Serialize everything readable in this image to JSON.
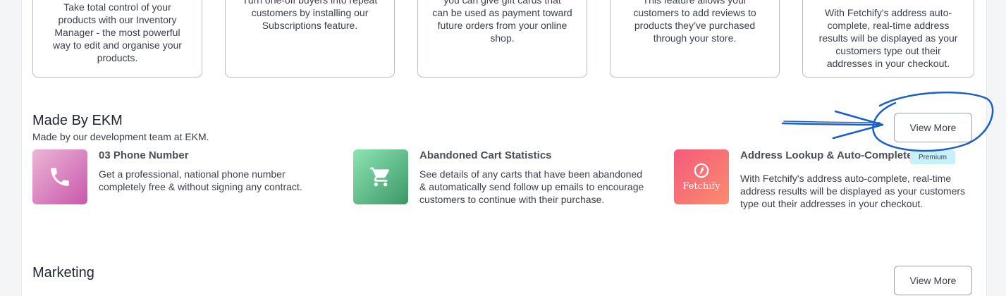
{
  "top_cards": [
    {
      "desc": "Take total control of your\nproducts with our Inventory\nManager - the most powerful\nway to edit and organise your\nproducts."
    },
    {
      "desc": "Turn one-off buyers into repeat\ncustomers by installing our\nSubscriptions feature."
    },
    {
      "desc": "you can give gift cards that\ncan be used as payment toward\nfuture orders from your online\nshop."
    },
    {
      "desc": "This feature allows your\ncustomers to add reviews to\nproducts they’ve purchased\nthrough your store."
    },
    {
      "desc": "With Fetchify's address auto-\ncomplete, real-time address\nresults will be displayed as your\ncustomers type out their\naddresses in your checkout."
    }
  ],
  "made_by_ekm": {
    "title": "Made By EKM",
    "subtitle": "Made by our development team at EKM.",
    "view_more": "View More",
    "apps": [
      {
        "name": "03 Phone Number",
        "text": "Get a professional, national phone number\ncompletely free & without signing any contract.",
        "icon": "phone-icon"
      },
      {
        "name": "Abandoned Cart Statistics",
        "text": "See details of any carts that have been abandoned\n& automatically send follow up emails to encourage\ncustomers to continue with their purchase.",
        "icon": "cart-icon"
      },
      {
        "name": "Address Lookup & Auto-Complete",
        "text": "With Fetchify's address auto-complete, real-time\naddress results will be displayed as your customers\ntype out their addresses in your checkout.",
        "icon": "fetchify-logo",
        "logo_text": "Fetchify",
        "badge": "Premium"
      }
    ]
  },
  "marketing": {
    "title": "Marketing",
    "view_more": "View More"
  },
  "colors": {
    "phone_tile": "#d470b5",
    "cart_tile": "#4fb980",
    "fetchify_tile": "#f56f78",
    "badge_bg": "#c7f0fb",
    "annotation": "#1a5fc8"
  }
}
